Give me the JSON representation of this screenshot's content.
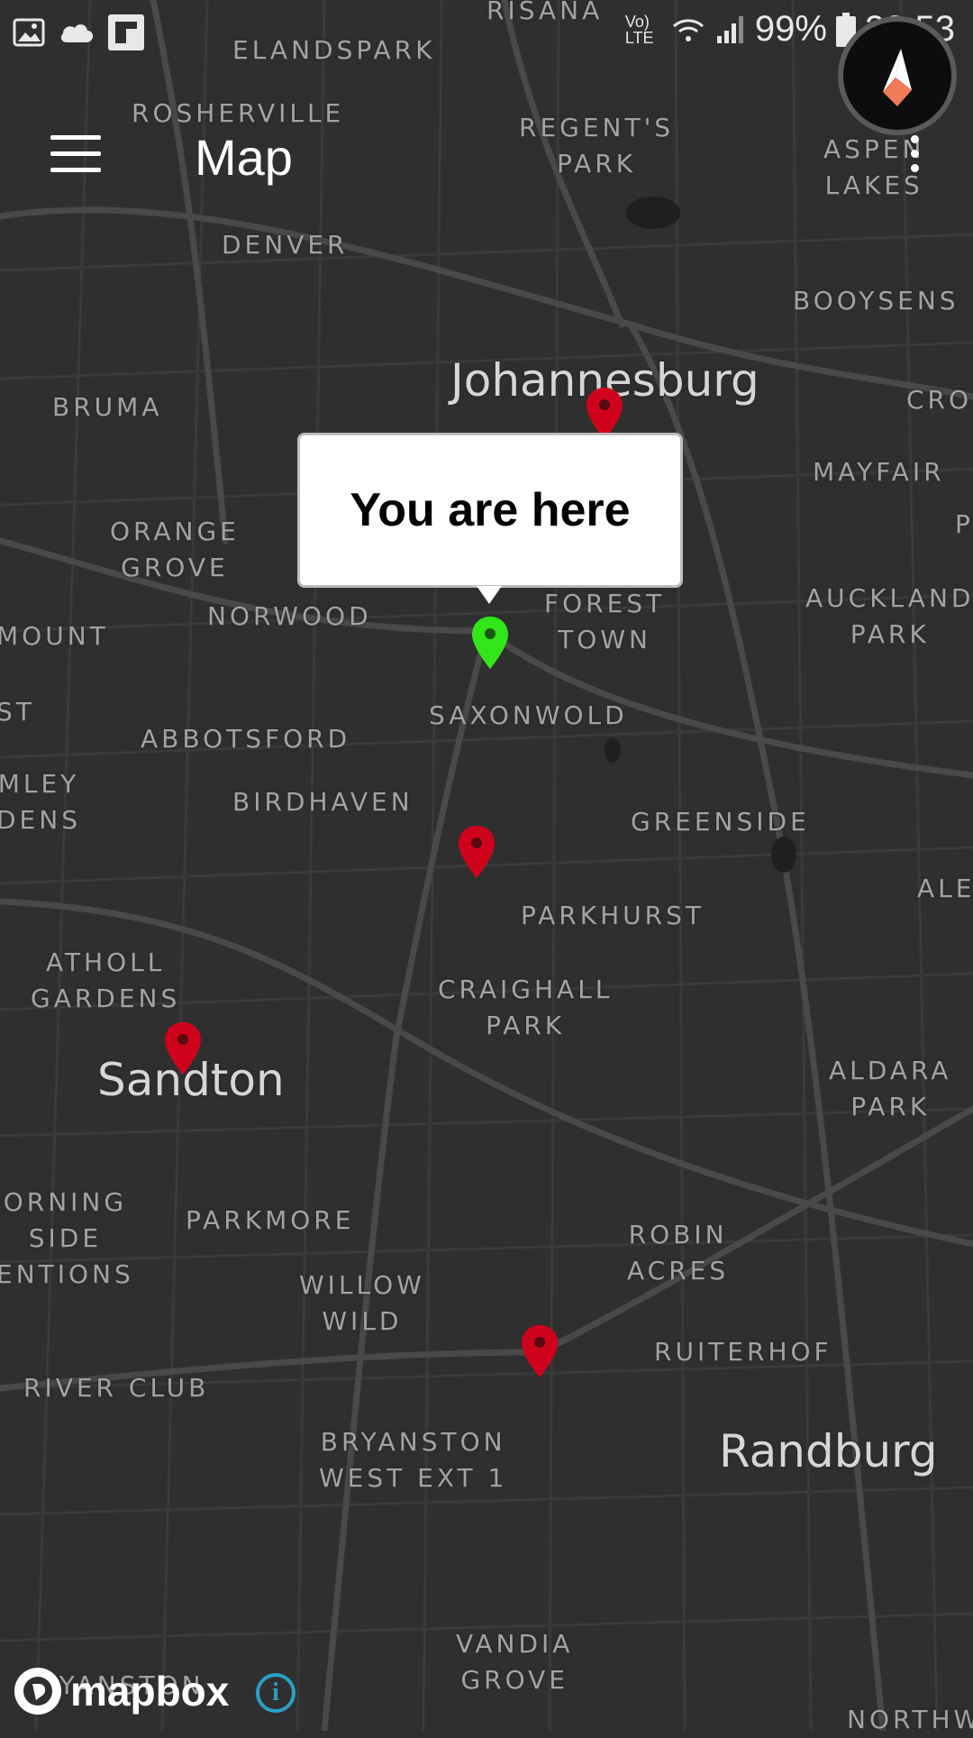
{
  "status_bar": {
    "battery": "99%",
    "time": "22:53",
    "network": "Vo) LTE"
  },
  "app_bar": {
    "title": "Map"
  },
  "popup": {
    "text": "You are here"
  },
  "map": {
    "attribution_logo": "mapbox",
    "places": [
      "RISANA",
      "ELANDSPARK",
      "ROSHERVILLE",
      "REGENT'S\nPARK",
      "ASPEN\nLAKES",
      "DENVER",
      "BOOYSENS",
      "Johannesburg",
      "BRUMA",
      "CRO",
      "MAYFAIR",
      "ORANGE\nGROVE",
      "NORWOOD",
      "FOREST\nTOWN",
      "AUCKLAND\nPARK",
      "MOUNT",
      "ST",
      "SAXONWOLD",
      "ABBOTSFORD",
      "MLEY\nDENS",
      "BIRDHAVEN",
      "GREENSIDE",
      "ALE",
      "PARKHURST",
      "ATHOLL\nGARDENS",
      "CRAIGHALL\nPARK",
      "Sandton",
      "ALDARA\nPARK",
      "ORNING\nSIDE\nENTIONS",
      "PARKMORE",
      "ROBIN\nACRES",
      "WILLOW\nWILD",
      "RUITERHOF",
      "RIVER CLUB",
      "BRYANSTON\nWEST EXT 1",
      "Randburg",
      "VANDIA\nGROVE",
      "NORTHW",
      "P",
      "RYANSTON"
    ]
  },
  "colors": {
    "map_bg": "#2f2f2f",
    "road": "#444444",
    "marker_red": "#d0021b",
    "marker_green": "#33e61a",
    "info_blue": "#2aa0c6"
  }
}
